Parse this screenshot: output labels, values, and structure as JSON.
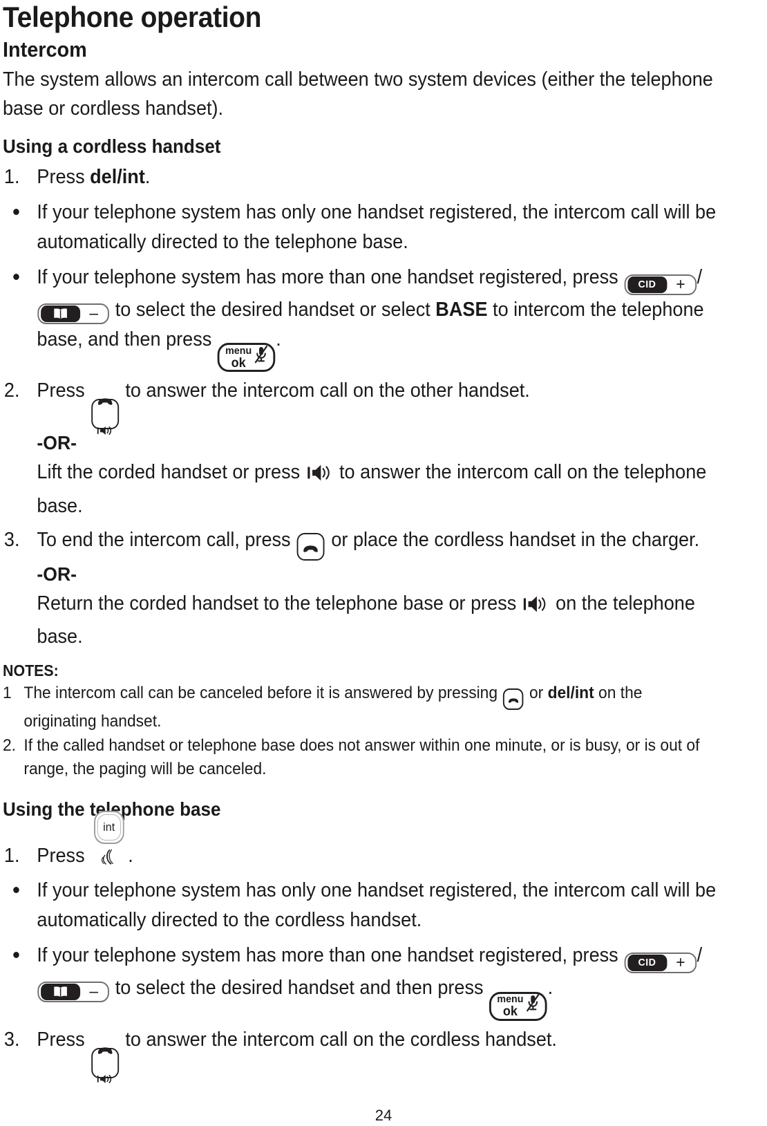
{
  "document": {
    "title": "Telephone operation",
    "section": "Intercom",
    "intro": "The system allows an intercom call between two system devices (either the telephone base or cordless handset).",
    "page_number": "24"
  },
  "cordless": {
    "heading": "Using a cordless handset",
    "step1": {
      "marker": "1.",
      "press_label": "Press",
      "key_label": "del/int",
      "period": "."
    },
    "bullet1": "If your telephone system has only one handset registered, the intercom call will be automatically directed to the telephone base.",
    "bullet2": {
      "lead": "If your telephone system has more than one handset registered, press",
      "slash": "/",
      "mid": "to select the desired handset or select",
      "base_label": "BASE",
      "tail": "to intercom the telephone base, and then press",
      "period": "."
    },
    "step2": {
      "marker": "2.",
      "press_label": "Press",
      "after_key": "to answer the intercom call on the other handset.",
      "or_label": "-OR-",
      "alt_lead": "Lift the corded handset or press",
      "alt_tail": "to answer the intercom call on the telephone base."
    },
    "step3": {
      "marker": "3.",
      "lead": "To end the intercom call, press",
      "tail": "or place the cordless handset in the charger.",
      "or_label": "-OR-",
      "alt_lead": "Return the corded handset to the telephone base or press",
      "alt_tail": "on the telephone base."
    }
  },
  "notes": {
    "heading": "NOTES:",
    "items": [
      {
        "marker": "1",
        "lead": "The intercom call can be canceled before it is answered by pressing",
        "mid": "or",
        "key_label": "del/int",
        "tail": "on the originating handset."
      },
      {
        "marker": "2.",
        "text": "If the called handset or telephone base does not answer within one minute, or is busy, or is out of range, the paging will be canceled."
      }
    ]
  },
  "base": {
    "heading": "Using the telephone base",
    "step1": {
      "marker": "1.",
      "press_label": "Press",
      "period": "."
    },
    "bullet1": "If your telephone system has only one handset registered, the intercom call will be automatically directed to the cordless handset.",
    "bullet2": {
      "lead": "If your telephone system has more than one handset registered, press",
      "slash": "/",
      "mid": "to select the desired handset and then press",
      "period": "."
    },
    "step3": {
      "marker": "3.",
      "press_label": "Press",
      "after_key": "to answer the intercom call on the cordless handset."
    }
  },
  "keys": {
    "cid_chip": "CID",
    "cid_sign": "+",
    "dir_sign": "–",
    "menu_line1": "menu",
    "menu_line2": "ok",
    "int_label": "int"
  },
  "colors": {
    "ink": "#1a1a1a",
    "key_fill": "#231f20",
    "key_border": "#6f6f6f"
  }
}
